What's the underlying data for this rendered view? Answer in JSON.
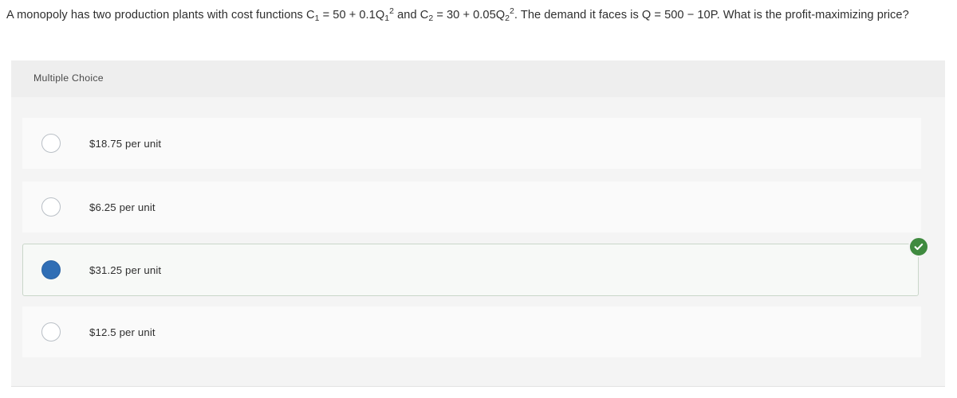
{
  "question": {
    "segments": [
      {
        "t": "text",
        "v": "A monopoly has two production plants with cost functions C"
      },
      {
        "t": "sub",
        "v": "1"
      },
      {
        "t": "text",
        "v": " = 50 + 0.1Q"
      },
      {
        "t": "sub",
        "v": "1"
      },
      {
        "t": "sup",
        "v": "2"
      },
      {
        "t": "text",
        "v": " and C"
      },
      {
        "t": "sub",
        "v": "2"
      },
      {
        "t": "text",
        "v": " = 30 + 0.05Q"
      },
      {
        "t": "sub",
        "v": "2"
      },
      {
        "t": "sup",
        "v": "2"
      },
      {
        "t": "text",
        "v": ". The demand it faces is Q = 500 − 10P. What is the profit-maximizing price?"
      }
    ],
    "plain": "A monopoly has two production plants with cost functions C1 = 50 + 0.1Q1² and C2 = 30 + 0.05Q2². The demand it faces is Q = 500 − 10P. What is the profit-maximizing price?"
  },
  "card": {
    "header_label": "Multiple Choice",
    "options": [
      {
        "label": "$18.75 per unit",
        "selected": false,
        "correct": false
      },
      {
        "label": "$6.25 per unit",
        "selected": false,
        "correct": false
      },
      {
        "label": "$31.25 per unit",
        "selected": true,
        "correct": true
      },
      {
        "label": "$12.5 per unit",
        "selected": false,
        "correct": false
      }
    ],
    "correct_badge_icon": "check-circle-icon"
  },
  "colors": {
    "page_background": "#ffffff",
    "card_background": "#f4f4f4",
    "card_header_background": "#eeeeee",
    "option_row_background": "#fafafa",
    "selected_row_background": "#f7f9f7",
    "selected_row_border": "#c9d6c9",
    "radio_selected_fill": "#2f6eb5",
    "radio_unselected_border": "#b9bfc6",
    "correct_badge_green": "#3f8a3f",
    "text_primary": "#2f2f2f"
  }
}
